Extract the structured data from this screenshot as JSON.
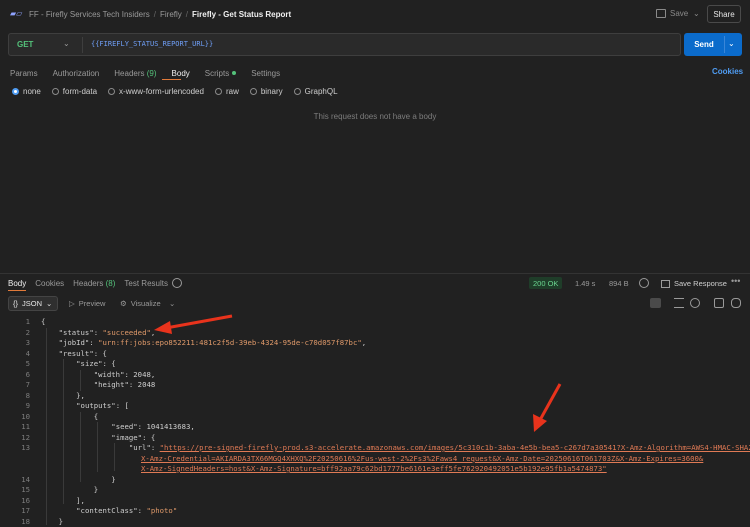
{
  "topbar": {
    "breadcrumb": [
      "FF - Firefly Services Tech Insiders",
      "Firefly",
      "Firefly - Get Status Report"
    ],
    "save_label": "Save",
    "share_label": "Share"
  },
  "request": {
    "method": "GET",
    "url": "{{FIREFLY_STATUS_REPORT_URL}}",
    "send_label": "Send",
    "tabs": [
      {
        "label": "Params"
      },
      {
        "label": "Authorization"
      },
      {
        "label": "Headers",
        "count": "(9)"
      },
      {
        "label": "Body",
        "active": true
      },
      {
        "label": "Scripts",
        "dot": true
      },
      {
        "label": "Settings"
      }
    ],
    "cookies_label": "Cookies",
    "body_types": [
      "none",
      "form-data",
      "x-www-form-urlencoded",
      "raw",
      "binary",
      "GraphQL"
    ],
    "selected_body_type": "none",
    "no_body_message": "This request does not have a body"
  },
  "response": {
    "tabs": [
      {
        "label": "Body",
        "active": true
      },
      {
        "label": "Cookies"
      },
      {
        "label": "Headers",
        "count": "(8)"
      },
      {
        "label": "Test Results"
      }
    ],
    "status": "200 OK",
    "time": "1.49 s",
    "size": "894 B",
    "save_label": "Save Response",
    "format": "JSON",
    "preview_label": "Preview",
    "visualize_label": "Visualize",
    "line_numbers": [
      "1",
      "2",
      "3",
      "4",
      "5",
      "6",
      "7",
      "8",
      "9",
      "10",
      "11",
      "12",
      "13",
      "14",
      "15",
      "16",
      "17",
      "18"
    ],
    "json": {
      "status_key": "\"status\"",
      "status_val": "\"succeeded\"",
      "jobid_key": "\"jobId\"",
      "jobid_val": "\"urn:ff:jobs:epo852211:481c2f5d-39eb-4324-95de-c70d057f87bc\"",
      "result_key": "\"result\"",
      "size_key": "\"size\"",
      "width_key": "\"width\"",
      "width_val": "2048",
      "height_key": "\"height\"",
      "height_val": "2048",
      "outputs_key": "\"outputs\"",
      "seed_key": "\"seed\"",
      "seed_val": "1041413683",
      "image_key": "\"image\"",
      "url_key": "\"url\"",
      "url_line1": "\"https://pre-signed-firefly-prod.s3-accelerate.amazonaws.com/images/5c310c1b-3aba-4e5b-bea5-c267d7a30541?X-Amz-Algorithm=AWS4-HMAC-SHA256&",
      "url_line2": "X-Amz-Credential=AKIARDA3TX66MGQ4XHXQ%2F20250616%2Fus-west-2%2Fs3%2Faws4_request&X-Amz-Date=20250616T061703Z&X-Amz-Expires=3600&",
      "url_line3": "X-Amz-SignedHeaders=host&X-Amz-Signature=bff92aa79c62bd1777be6161e3eff5fe762920492051e5b192e95fb1a5474873\"",
      "contentclass_key": "\"contentClass\"",
      "contentclass_val": "\"photo\""
    }
  },
  "colors": {
    "send": "#0b6bcb",
    "method": "#54c17a",
    "accent": "#e07a3a",
    "annotation_arrow": "#e8331c"
  }
}
